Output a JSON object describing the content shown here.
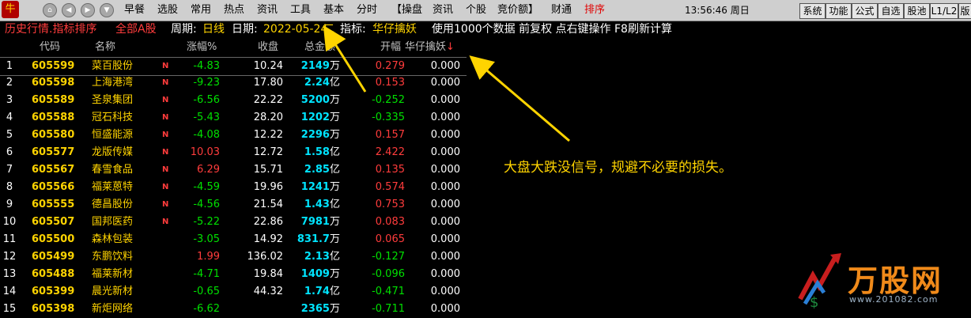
{
  "menubar": {
    "logo": "牛",
    "items": [
      "早餐",
      "选股",
      "常用",
      "热点",
      "资讯",
      "工具",
      "基本",
      "分时",
      "【操盘",
      "资讯",
      "个股",
      "竞价额】",
      "财通",
      "排序"
    ],
    "clock": "13:56:46 周日",
    "sys_buttons": [
      "系统",
      "功能",
      "公式",
      "自选",
      "股池",
      "L1/L2",
      "版"
    ]
  },
  "status": {
    "title": "历史行情.指标排序",
    "market": "全部A股",
    "period_label": "周期:",
    "period": "日线",
    "date_label": "日期:",
    "date": "2022-05-24",
    "weekday": "二",
    "indicator_label": "指标:",
    "indicator": "华仔擒妖",
    "note": "使用1000个数据 前复权 点右键操作 F8刷新计算"
  },
  "table": {
    "headers": {
      "code": "代码",
      "name": "名称",
      "change": "涨幅%",
      "close": "收盘",
      "amount": "总金额",
      "open": "开幅",
      "indicator": "华仔擒妖"
    },
    "rows": [
      {
        "idx": "1",
        "code": "605599",
        "name": "菜百股份",
        "flag": "N",
        "change": "-4.83",
        "close": "10.24",
        "amount_num": "2149",
        "amount_unit": "万",
        "open": "0.279",
        "ind": "0.000"
      },
      {
        "idx": "2",
        "code": "605598",
        "name": "上海港湾",
        "flag": "N",
        "change": "-9.23",
        "close": "17.80",
        "amount_num": "2.24",
        "amount_unit": "亿",
        "open": "0.153",
        "ind": "0.000"
      },
      {
        "idx": "3",
        "code": "605589",
        "name": "圣泉集团",
        "flag": "N",
        "change": "-6.56",
        "close": "22.22",
        "amount_num": "5200",
        "amount_unit": "万",
        "open": "-0.252",
        "ind": "0.000"
      },
      {
        "idx": "4",
        "code": "605588",
        "name": "冠石科技",
        "flag": "N",
        "change": "-5.43",
        "close": "28.20",
        "amount_num": "1202",
        "amount_unit": "万",
        "open": "-0.335",
        "ind": "0.000"
      },
      {
        "idx": "5",
        "code": "605580",
        "name": "恒盛能源",
        "flag": "N",
        "change": "-4.08",
        "close": "12.22",
        "amount_num": "2296",
        "amount_unit": "万",
        "open": "0.157",
        "ind": "0.000"
      },
      {
        "idx": "6",
        "code": "605577",
        "name": "龙版传媒",
        "flag": "N",
        "change": "10.03",
        "close": "12.72",
        "amount_num": "1.58",
        "amount_unit": "亿",
        "open": "2.422",
        "ind": "0.000"
      },
      {
        "idx": "7",
        "code": "605567",
        "name": "春雪食品",
        "flag": "N",
        "change": "6.29",
        "close": "15.71",
        "amount_num": "2.85",
        "amount_unit": "亿",
        "open": "0.135",
        "ind": "0.000"
      },
      {
        "idx": "8",
        "code": "605566",
        "name": "福莱蒽特",
        "flag": "N",
        "change": "-4.59",
        "close": "19.96",
        "amount_num": "1241",
        "amount_unit": "万",
        "open": "0.574",
        "ind": "0.000"
      },
      {
        "idx": "9",
        "code": "605555",
        "name": "德昌股份",
        "flag": "N",
        "change": "-4.56",
        "close": "21.54",
        "amount_num": "1.43",
        "amount_unit": "亿",
        "open": "0.753",
        "ind": "0.000"
      },
      {
        "idx": "10",
        "code": "605507",
        "name": "国邦医药",
        "flag": "N",
        "change": "-5.22",
        "close": "22.86",
        "amount_num": "7981",
        "amount_unit": "万",
        "open": "0.083",
        "ind": "0.000"
      },
      {
        "idx": "11",
        "code": "605500",
        "name": "森林包装",
        "flag": "",
        "change": "-3.05",
        "close": "14.92",
        "amount_num": "831.7",
        "amount_unit": "万",
        "open": "0.065",
        "ind": "0.000"
      },
      {
        "idx": "12",
        "code": "605499",
        "name": "东鹏饮料",
        "flag": "",
        "change": "1.99",
        "close": "136.02",
        "amount_num": "2.13",
        "amount_unit": "亿",
        "open": "-0.127",
        "ind": "0.000"
      },
      {
        "idx": "13",
        "code": "605488",
        "name": "福莱新材",
        "flag": "",
        "change": "-4.71",
        "close": "19.84",
        "amount_num": "1409",
        "amount_unit": "万",
        "open": "-0.096",
        "ind": "0.000"
      },
      {
        "idx": "14",
        "code": "605399",
        "name": "晨光新材",
        "flag": "",
        "change": "-0.65",
        "close": "44.32",
        "amount_num": "1.74",
        "amount_unit": "亿",
        "open": "-0.471",
        "ind": "0.000"
      },
      {
        "idx": "15",
        "code": "605398",
        "name": "新炬网络",
        "flag": "",
        "change": "-6.62",
        "close": "",
        "amount_num": "2365",
        "amount_unit": "万",
        "open": "-0.711",
        "ind": "0.000"
      }
    ]
  },
  "annotation": "大盘大跌没信号，规避不必要的损失。",
  "watermark": {
    "text": "万股网",
    "url": "www.201082.com"
  },
  "colors": {
    "red": "#ff3c3c",
    "green": "#00e000",
    "yellow": "#ffd400",
    "cyan": "#00e4ff"
  }
}
